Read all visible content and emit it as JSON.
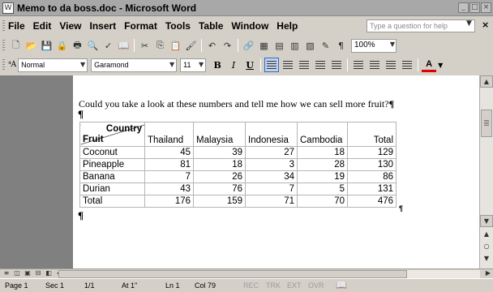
{
  "window": {
    "title": "Memo to da boss.doc - Microsoft Word",
    "app_icon": "word-doc-icon"
  },
  "menu": {
    "items": [
      "File",
      "Edit",
      "View",
      "Insert",
      "Format",
      "Tools",
      "Table",
      "Window",
      "Help"
    ],
    "help_placeholder": "Type a question for help"
  },
  "toolbar": {
    "zoom": "100%"
  },
  "format": {
    "style": "Normal",
    "font": "Garamond",
    "size": "11",
    "bold": "B",
    "italic": "I",
    "underline": "U",
    "font_color": "A"
  },
  "document": {
    "body": "Could you take a look at these numbers and tell me how we can sell more fruit?",
    "pilcrow": "¶",
    "table": {
      "corner_top": "Country",
      "corner_bottom": "Fruit",
      "columns": [
        "Thailand",
        "Malaysia",
        "Indonesia",
        "Cambodia",
        "Total"
      ],
      "rows": [
        {
          "label": "Coconut",
          "values": [
            "45",
            "39",
            "27",
            "18",
            "129"
          ]
        },
        {
          "label": "Pineapple",
          "values": [
            "81",
            "18",
            "3",
            "28",
            "130"
          ]
        },
        {
          "label": "Banana",
          "values": [
            "7",
            "26",
            "34",
            "19",
            "86"
          ]
        },
        {
          "label": "Durian",
          "values": [
            "43",
            "76",
            "7",
            "5",
            "131"
          ]
        },
        {
          "label": "Total",
          "values": [
            "176",
            "159",
            "71",
            "70",
            "476"
          ]
        }
      ]
    }
  },
  "status": {
    "page": "Page 1",
    "sec": "Sec 1",
    "pages": "1/1",
    "at": "At 1\"",
    "ln": "Ln 1",
    "col": "Col 79",
    "rec": "REC",
    "trk": "TRK",
    "ext": "EXT",
    "ovr": "OVR"
  }
}
